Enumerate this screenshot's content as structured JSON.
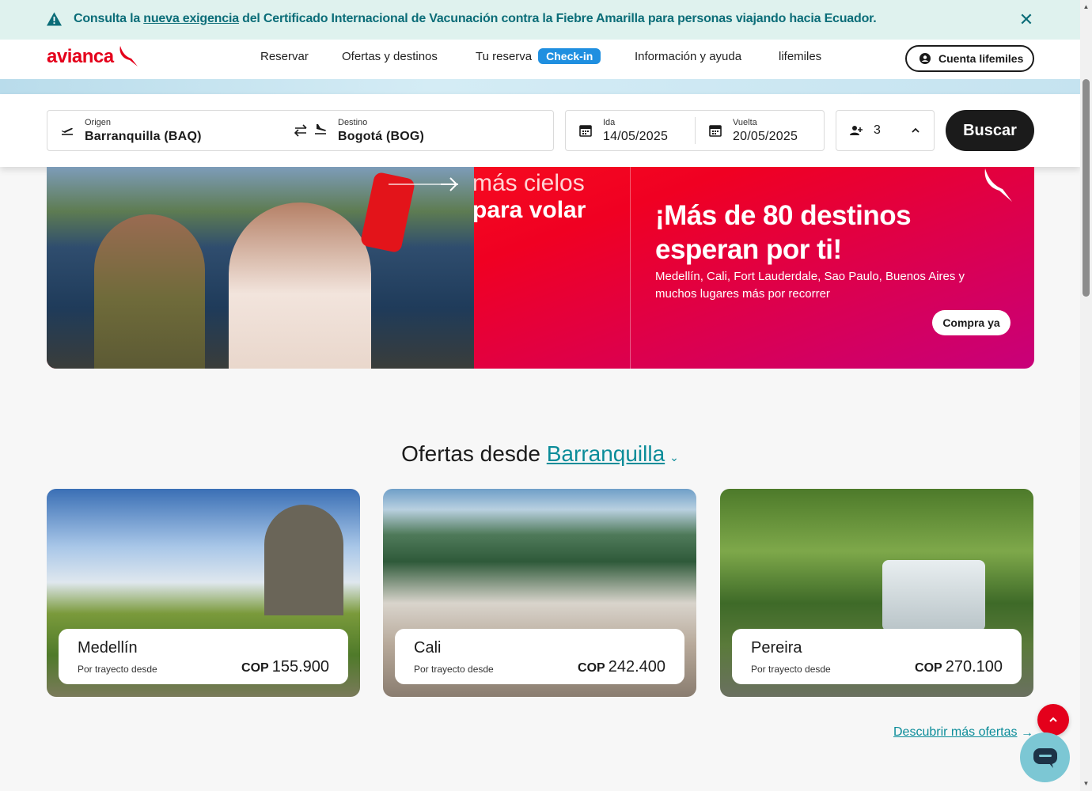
{
  "alert": {
    "prefix": "Consulta la ",
    "link": "nueva exigencia",
    "suffix": " del Certificado Internacional de Vacunación contra la Fiebre Amarilla para personas viajando hacia Ecuador.",
    "close_icon": "close-icon"
  },
  "header": {
    "logo": "avianca",
    "nav": [
      "Reservar",
      "Ofertas y destinos",
      "Tu reserva",
      "Información y ayuda",
      "lifemiles"
    ],
    "checkin": "Check-in",
    "account": "Cuenta lifemiles"
  },
  "search": {
    "origin_label": "Origen",
    "origin_value": "Barranquilla  (BAQ)",
    "dest_label": "Destino",
    "dest_value": "Bogotá  (BOG)",
    "ida_label": "Ida",
    "ida_value": "14/05/2025",
    "vuelta_label": "Vuelta",
    "vuelta_value": "20/05/2025",
    "passengers": "3",
    "button": "Buscar"
  },
  "promo": {
    "tagline_top": "más cielos",
    "tagline_bottom": "para volar",
    "headline": "¡Más de 80 destinos esperan por ti!",
    "subtext": "Medellín, Cali, Fort Lauderdale, Sao Paulo, Buenos Aires y muchos lugares más por recorrer",
    "cta": "Compra ya"
  },
  "offers": {
    "title_prefix": "Ofertas desde ",
    "city": "Barranquilla",
    "cards": [
      {
        "city": "Medellín",
        "desde": "Por trayecto desde",
        "currency": "COP",
        "price": "155.900"
      },
      {
        "city": "Cali",
        "desde": "Por trayecto desde",
        "currency": "COP",
        "price": "242.400"
      },
      {
        "city": "Pereira",
        "desde": "Por trayecto desde",
        "currency": "COP",
        "price": "270.100"
      }
    ],
    "more": "Descubrir más ofertas"
  },
  "colors": {
    "brand": "#e4001b",
    "teal": "#0b8c99",
    "alert_bg": "#dff2ee"
  }
}
